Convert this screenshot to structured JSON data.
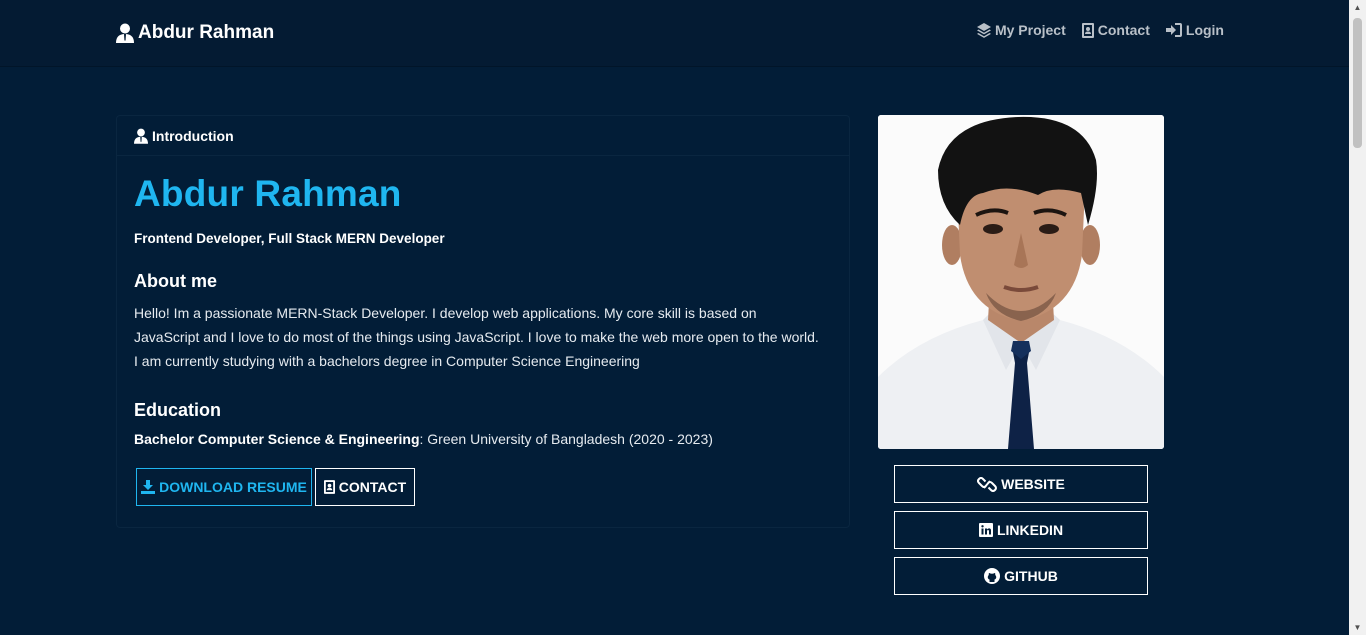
{
  "nav": {
    "brand": "Abdur Rahman",
    "links": [
      {
        "label": "My Project",
        "icon": "layers-icon"
      },
      {
        "label": "Contact",
        "icon": "contact-card-icon"
      },
      {
        "label": "Login",
        "icon": "login-icon"
      }
    ]
  },
  "intro": {
    "header": "Introduction",
    "name": "Abdur Rahman",
    "role": "Frontend Developer, Full Stack MERN Developer",
    "about_title": "About me",
    "about_text": "Hello! Im a passionate MERN-Stack Developer. I develop web applications. My core skill is based on JavaScript and I love to do most of the things using JavaScript. I love to make the web more open to the world. I am currently studying with a bachelors degree in Computer Science Engineering",
    "education_title": "Education",
    "education_degree": "Bachelor Computer Science & Engineering",
    "education_detail": ": Green University of Bangladesh (2020 - 2023)",
    "buttons": {
      "resume": "DOWNLOAD RESUME",
      "contact": "CONTACT"
    }
  },
  "social": {
    "website": "WEBSITE",
    "linkedin": "LINKEDIN",
    "github": "GITHUB"
  },
  "colors": {
    "background": "#021d37",
    "navbar": "#041b33",
    "accent": "#1fb6f0"
  }
}
